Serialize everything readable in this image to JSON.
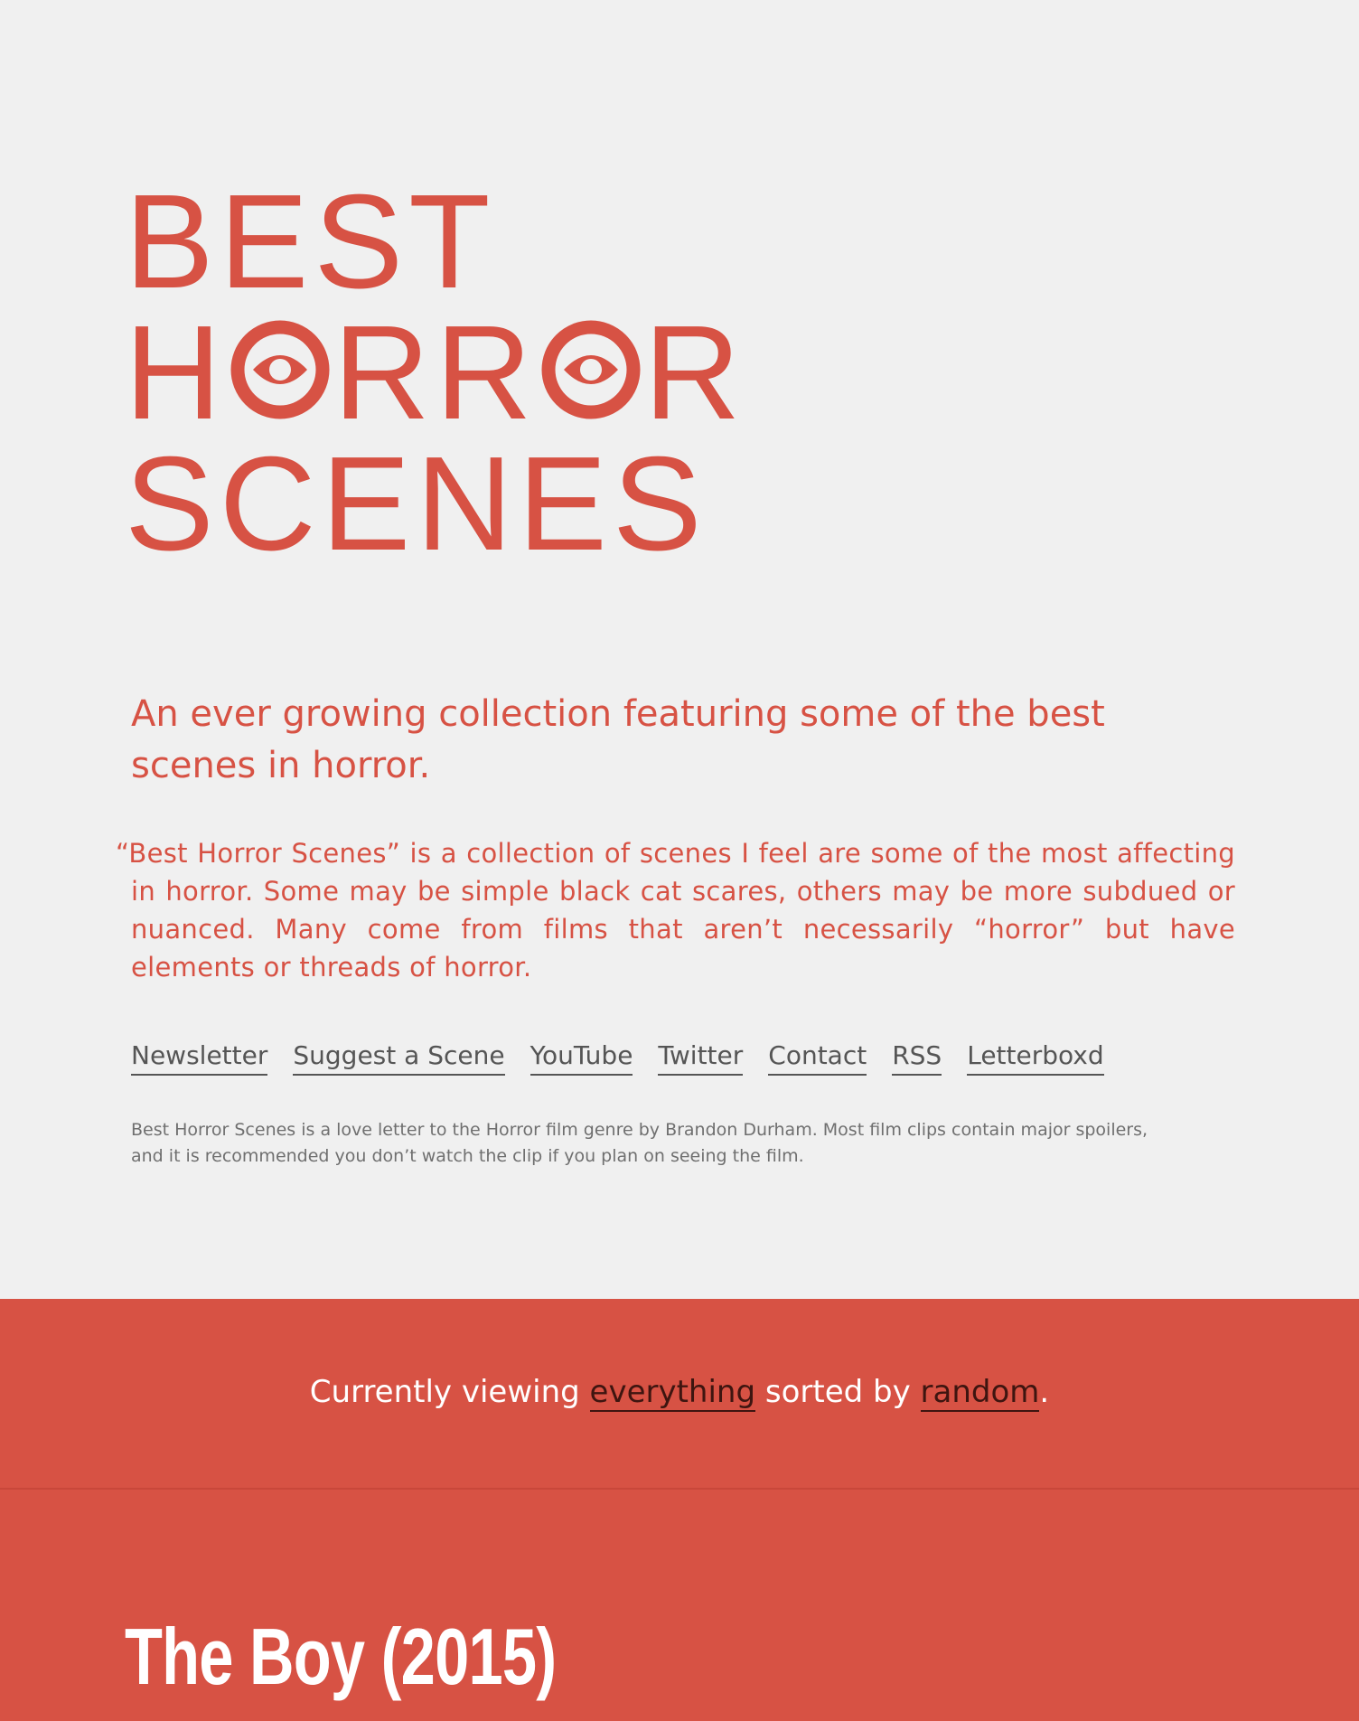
{
  "logo": {
    "line1": "BEST",
    "line2_h": "H",
    "line2_rr": "RR",
    "line2_r": "R",
    "line3": "SCENES"
  },
  "tagline": "An ever growing collection featuring some of the best scenes in horror.",
  "about": "“Best Horror Scenes” is a collection of scenes I feel are some of the most affecting in horror. Some may be simple black cat scares, others may be more subdued or nuanced. Many come from films that aren’t necessarily “horror” but have elements or threads of horror.",
  "nav": {
    "newsletter": "Newsletter",
    "suggest": "Suggest a Scene",
    "youtube": "YouTube",
    "twitter": "Twitter",
    "contact": "Contact",
    "rss": "RSS",
    "letterboxd": "Letterboxd"
  },
  "footnote": "Best Horror Scenes is a love letter to the Horror film genre by Brandon Durham. Most film clips contain major spoilers, and it is recommended you don’t watch the clip if you plan on seeing the film.",
  "filter": {
    "prefix": "Currently viewing ",
    "category": "everything",
    "middle": " sorted by ",
    "sort": "random",
    "suffix": "."
  },
  "scene": {
    "title": "The Boy (2015)"
  },
  "colors": {
    "accent": "#d75244",
    "background": "#f0f0f0",
    "link_dark": "#3e1510",
    "nav_text": "#555555"
  },
  "icons": {
    "logo_letter_o": "eye-icon"
  }
}
